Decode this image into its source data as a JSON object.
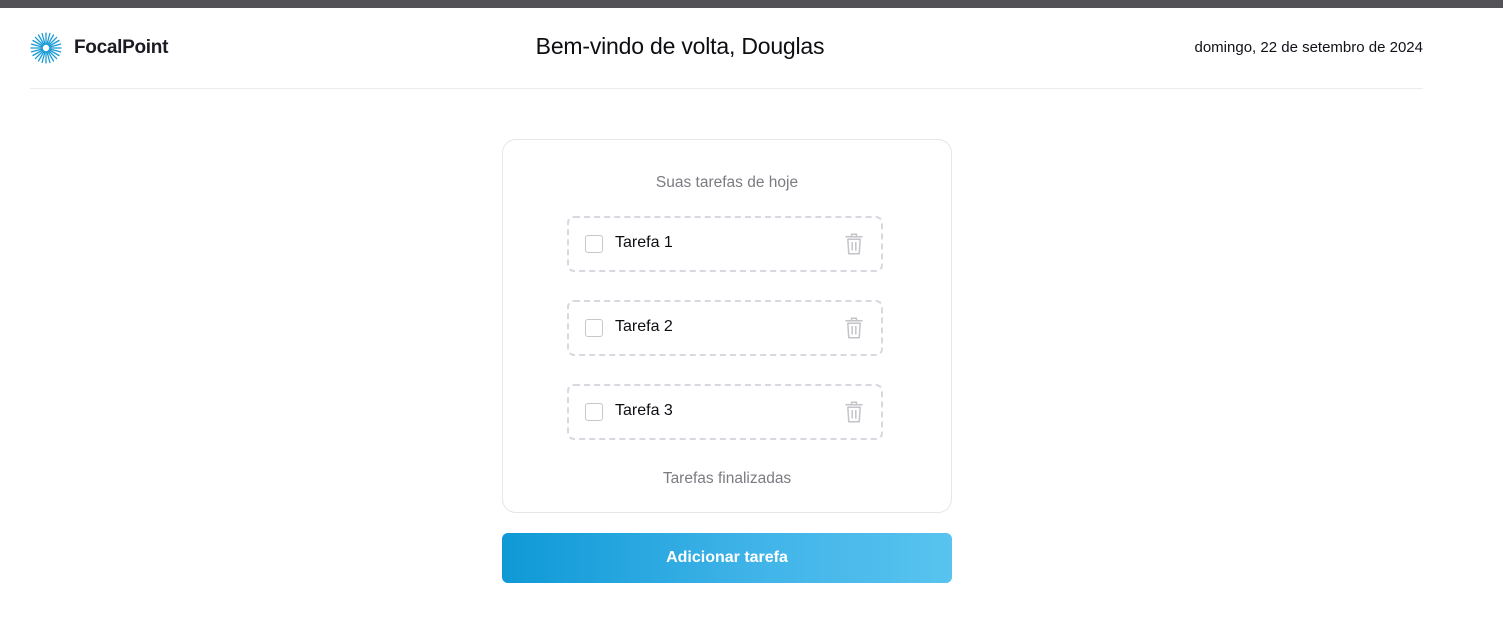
{
  "app": {
    "name": "FocalPoint",
    "logo_icon": "starburst-icon",
    "accent_color": "#1a9bd7"
  },
  "header": {
    "welcome": "Bem-vindo de volta, Douglas",
    "date": "domingo, 22 de setembro de 2024"
  },
  "tasks": {
    "title": "Suas tarefas de hoje",
    "items": [
      {
        "label": "Tarefa 1",
        "checked": false,
        "delete_icon": "trash-icon"
      },
      {
        "label": "Tarefa 2",
        "checked": false,
        "delete_icon": "trash-icon"
      },
      {
        "label": "Tarefa 3",
        "checked": false,
        "delete_icon": "trash-icon"
      }
    ],
    "finished_title": "Tarefas finalizadas"
  },
  "actions": {
    "add_task_label": "Adicionar tarefa"
  }
}
